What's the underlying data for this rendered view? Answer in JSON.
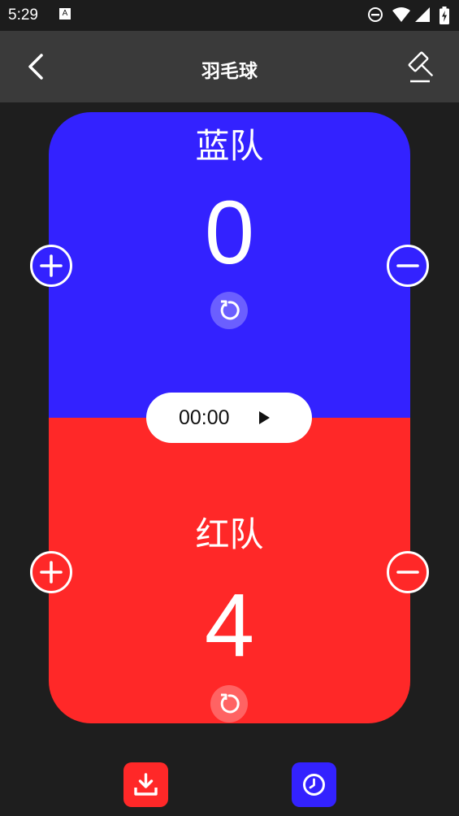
{
  "status_bar": {
    "time": "5:29",
    "badge": "A"
  },
  "app_bar": {
    "title": "羽毛球"
  },
  "blue_team": {
    "name": "蓝队",
    "score": "0",
    "color": "#3322ff"
  },
  "red_team": {
    "name": "红队",
    "score": "4",
    "color": "#ff2828"
  },
  "timer": {
    "display": "00:00"
  },
  "icons": {
    "status": [
      "dnd-icon",
      "wifi-icon",
      "signal-icon",
      "battery-charging-icon"
    ],
    "app_bar": [
      "back-arrow-icon",
      "hammer-icon"
    ],
    "controls": [
      "plus-icon",
      "minus-icon",
      "reset-icon",
      "play-icon"
    ],
    "bottom": [
      "download-icon",
      "clock-icon"
    ]
  }
}
